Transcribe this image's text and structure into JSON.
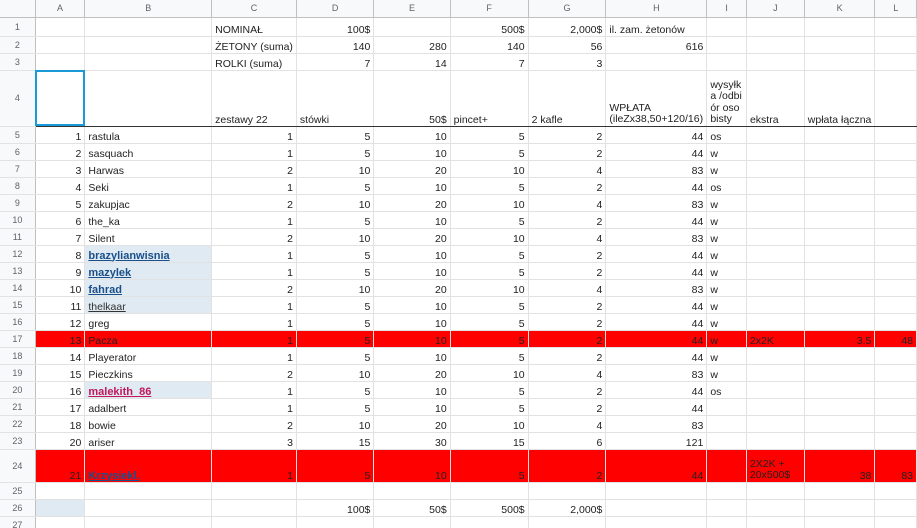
{
  "columns": [
    "A",
    "B",
    "C",
    "D",
    "E",
    "F",
    "G",
    "H",
    "I",
    "J",
    "K",
    "L"
  ],
  "top": {
    "r1": {
      "label": "NOMINAŁ",
      "d": "100$",
      "f": "500$",
      "g": "2,000$",
      "h": "il. zam. żetonów"
    },
    "r2": {
      "label": "ŻETONY (suma)",
      "d": "140",
      "e": "280",
      "f": "140",
      "g": "56",
      "h": "616"
    },
    "r3": {
      "label": "ROLKI (suma)",
      "d": "7",
      "e": "14",
      "f": "7",
      "g": "3"
    }
  },
  "header": {
    "c": "zestawy 22",
    "d": "stówki",
    "e": "50$",
    "f": "pincet+",
    "g": "2 kafle",
    "h": "WPŁATA (ileZx38,50+120/16)",
    "i": "wysyłka /odbiór osobisty",
    "j": "ekstra",
    "k": "wpłata łączna"
  },
  "rows": [
    {
      "n": "5",
      "a": "1",
      "b": "rastula",
      "c": "1",
      "d": "5",
      "e": "10",
      "f": "5",
      "g": "2",
      "h": "44",
      "i": "os"
    },
    {
      "n": "6",
      "a": "2",
      "b": "sasquach",
      "c": "1",
      "d": "5",
      "e": "10",
      "f": "5",
      "g": "2",
      "h": "44",
      "i": "w"
    },
    {
      "n": "7",
      "a": "3",
      "b": "Harwas",
      "c": "2",
      "d": "10",
      "e": "20",
      "f": "10",
      "g": "4",
      "h": "83",
      "i": "w"
    },
    {
      "n": "8",
      "a": "4",
      "b": "Seki",
      "c": "1",
      "d": "5",
      "e": "10",
      "f": "5",
      "g": "2",
      "h": "44",
      "i": "os"
    },
    {
      "n": "9",
      "a": "5",
      "b": "zakupjac",
      "c": "2",
      "d": "10",
      "e": "20",
      "f": "10",
      "g": "4",
      "h": "83",
      "i": "w"
    },
    {
      "n": "10",
      "a": "6",
      "b": "the_ka",
      "c": "1",
      "d": "5",
      "e": "10",
      "f": "5",
      "g": "2",
      "h": "44",
      "i": "w"
    },
    {
      "n": "11",
      "a": "7",
      "b": "Silent",
      "c": "2",
      "d": "10",
      "e": "20",
      "f": "10",
      "g": "4",
      "h": "83",
      "i": "w"
    },
    {
      "n": "12",
      "a": "8",
      "b": "brazylianwisnia",
      "style": "lnk",
      "c": "1",
      "d": "5",
      "e": "10",
      "f": "5",
      "g": "2",
      "h": "44",
      "i": "w"
    },
    {
      "n": "13",
      "a": "9",
      "b": "mazylek",
      "style": "lnk",
      "c": "1",
      "d": "5",
      "e": "10",
      "f": "5",
      "g": "2",
      "h": "44",
      "i": "w"
    },
    {
      "n": "14",
      "a": "10",
      "b": "fahrad",
      "style": "lnk",
      "c": "2",
      "d": "10",
      "e": "20",
      "f": "10",
      "g": "4",
      "h": "83",
      "i": "w"
    },
    {
      "n": "15",
      "a": "11",
      "b": "thelkaar",
      "style": "lnk-thin",
      "c": "1",
      "d": "5",
      "e": "10",
      "f": "5",
      "g": "2",
      "h": "44",
      "i": "w"
    },
    {
      "n": "16",
      "a": "12",
      "b": "greg",
      "c": "1",
      "d": "5",
      "e": "10",
      "f": "5",
      "g": "2",
      "h": "44",
      "i": "w"
    },
    {
      "n": "17",
      "a": "13",
      "b": "Pacza",
      "red": true,
      "c": "1",
      "d": "5",
      "e": "10",
      "f": "5",
      "g": "2",
      "h": "44",
      "i": "w",
      "j": "2x2K",
      "k": "3.5",
      "l": "48"
    },
    {
      "n": "18",
      "a": "14",
      "b": "Playerator",
      "c": "1",
      "d": "5",
      "e": "10",
      "f": "5",
      "g": "2",
      "h": "44",
      "i": "w"
    },
    {
      "n": "19",
      "a": "15",
      "b": "Pieczkins",
      "c": "2",
      "d": "10",
      "e": "20",
      "f": "10",
      "g": "4",
      "h": "83",
      "i": "w"
    },
    {
      "n": "20",
      "a": "16",
      "b": "malekith_86",
      "style": "lnk-red",
      "c": "1",
      "d": "5",
      "e": "10",
      "f": "5",
      "g": "2",
      "h": "44",
      "i": "os"
    },
    {
      "n": "21",
      "a": "17",
      "b": "adalbert",
      "c": "1",
      "d": "5",
      "e": "10",
      "f": "5",
      "g": "2",
      "h": "44"
    },
    {
      "n": "22",
      "a": "18",
      "b": "bowie",
      "c": "2",
      "d": "10",
      "e": "20",
      "f": "10",
      "g": "4",
      "h": "83"
    },
    {
      "n": "23",
      "a": "20",
      "b": "ariser",
      "c": "3",
      "d": "15",
      "e": "30",
      "f": "15",
      "g": "6",
      "h": "121"
    },
    {
      "n": "24",
      "a": "21",
      "b": "Krzysiekl.",
      "style": "lnk",
      "red": true,
      "tall": true,
      "c": "1",
      "d": "5",
      "e": "10",
      "f": "5",
      "g": "2",
      "h": "44",
      "j": "2X2K + 20x500$",
      "k": "38",
      "l": "83"
    }
  ],
  "bottom": {
    "d": "100$",
    "e": "50$",
    "f": "500$",
    "g": "2,000$"
  }
}
